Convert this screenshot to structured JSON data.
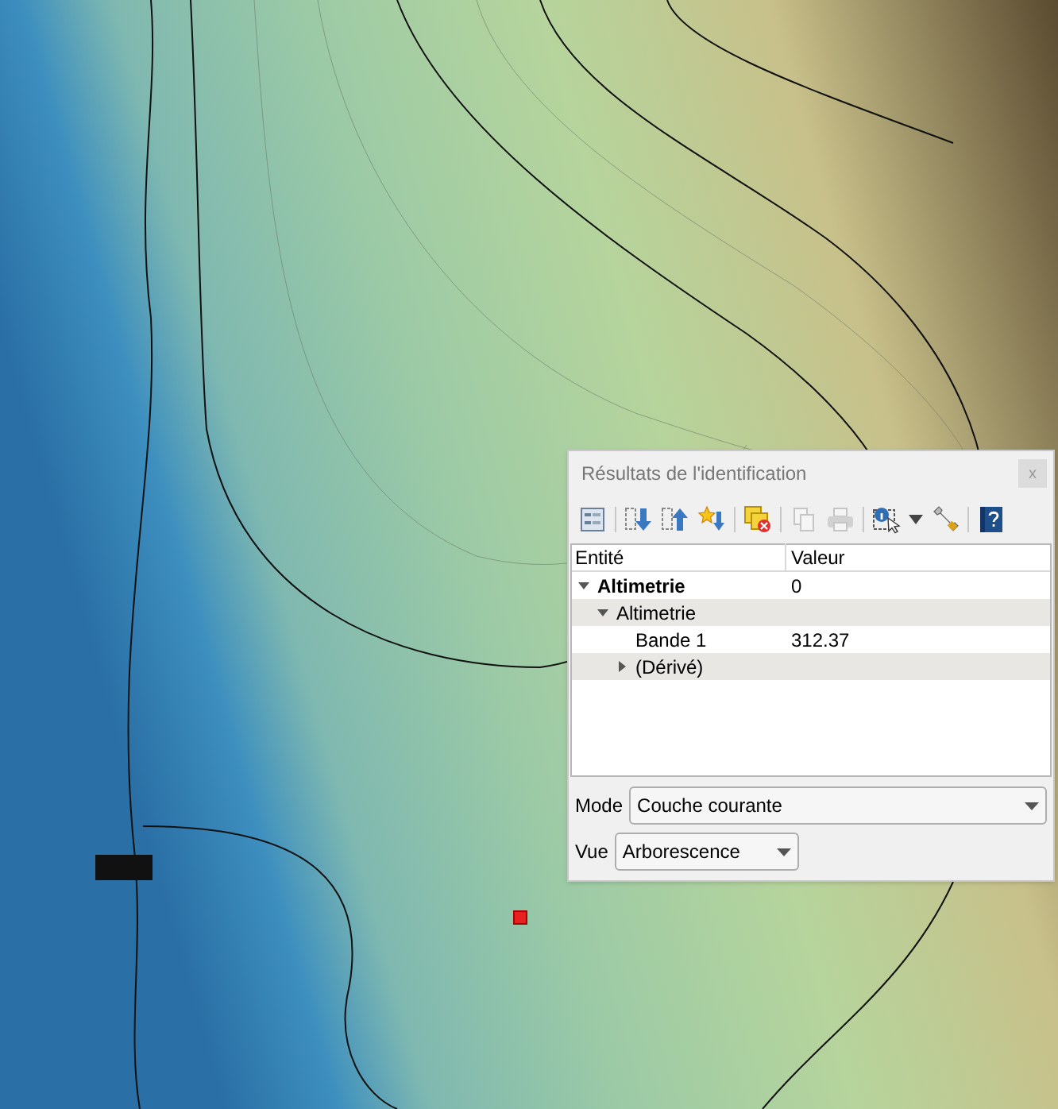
{
  "panel": {
    "title": "Résultats de l'identification",
    "close": "x",
    "toolbar": [
      {
        "kind": "expand",
        "disabled": false
      },
      {
        "kind": "sep"
      },
      {
        "kind": "down",
        "disabled": false
      },
      {
        "kind": "up",
        "disabled": false
      },
      {
        "kind": "star",
        "disabled": false
      },
      {
        "kind": "sep"
      },
      {
        "kind": "clear",
        "disabled": false
      },
      {
        "kind": "sep"
      },
      {
        "kind": "copy",
        "disabled": true
      },
      {
        "kind": "print",
        "disabled": true
      },
      {
        "kind": "sep"
      },
      {
        "kind": "select",
        "disabled": false
      },
      {
        "kind": "caret",
        "disabled": false
      },
      {
        "kind": "wrench",
        "disabled": false
      },
      {
        "kind": "sep"
      },
      {
        "kind": "help",
        "disabled": false
      }
    ],
    "columns": [
      "Entité",
      "Valeur"
    ],
    "tree": [
      {
        "label": "Altimetrie",
        "value": "0",
        "expanded": true,
        "children": [
          {
            "label": "Altimetrie",
            "expanded": true,
            "children": [
              {
                "label": "Bande 1",
                "value": "312.37"
              },
              {
                "label": "(Dérivé)",
                "expanded": false
              }
            ]
          }
        ]
      }
    ],
    "mode": {
      "label": "Mode",
      "value": "Couche courante"
    },
    "view": {
      "label": "Vue",
      "value": "Arborescence"
    }
  }
}
